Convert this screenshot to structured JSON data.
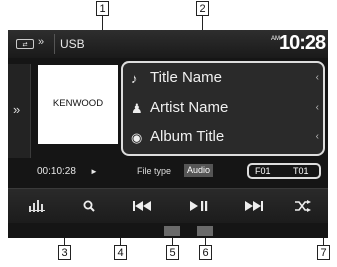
{
  "callouts": [
    "1",
    "2",
    "3",
    "4",
    "5",
    "6",
    "7"
  ],
  "topbar": {
    "source_icon": "USB-icon",
    "source": "USB",
    "am": "AM",
    "clock": "10:28"
  },
  "album_art": {
    "logo": "KENWOOD"
  },
  "track_info": [
    {
      "icon": "music-note-icon",
      "label": "Title Name"
    },
    {
      "icon": "artist-icon",
      "label": "Artist Name"
    },
    {
      "icon": "album-disc-icon",
      "label": "Album Title"
    }
  ],
  "status": {
    "elapsed": "00:10:28",
    "play_indicator": "►",
    "file_type_label": "File type",
    "file_type_value": "Audio",
    "folder": "F01",
    "track": "T01"
  },
  "controls": [
    {
      "name": "equalizer-button",
      "icon": "equalizer-icon"
    },
    {
      "name": "search-button",
      "icon": "search-icon"
    },
    {
      "name": "previous-button",
      "icon": "skip-previous-icon"
    },
    {
      "name": "play-pause-button",
      "icon": "play-pause-icon"
    },
    {
      "name": "next-button",
      "icon": "skip-next-icon"
    },
    {
      "name": "random-button",
      "icon": "shuffle-icon"
    }
  ]
}
